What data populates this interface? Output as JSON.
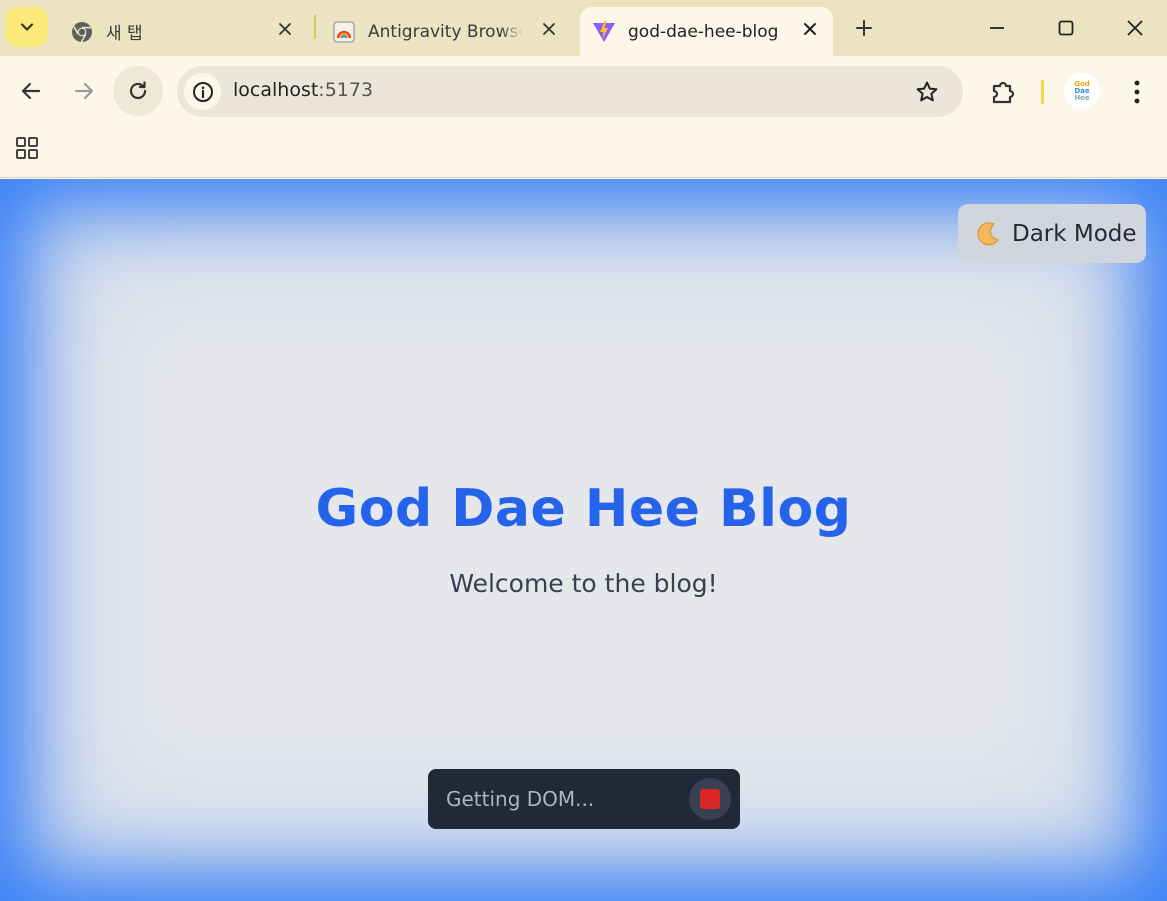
{
  "browser": {
    "tabs": [
      {
        "title": "새 탭",
        "favicon": "chrome-icon",
        "active": false
      },
      {
        "title": "Antigravity Browser",
        "favicon": "antigravity-icon",
        "active": false
      },
      {
        "title": "god-dae-hee-blog",
        "favicon": "vite-icon",
        "active": true
      }
    ],
    "address": {
      "host": "localhost",
      "port": ":5173"
    },
    "profile": {
      "line1": "God",
      "line2": "Dae",
      "line3": "Hee"
    }
  },
  "page": {
    "dark_mode_label": "Dark Mode",
    "title": "God Dae Hee Blog",
    "subtitle": "Welcome to the blog!",
    "agent_status": "Getting DOM..."
  },
  "colors": {
    "tabstrip": "#ece4c0",
    "toolbar": "#fdf7e9",
    "title_blue": "#2563eb",
    "agent_glow": "#3b82f6",
    "stop_red": "#dc2626"
  }
}
